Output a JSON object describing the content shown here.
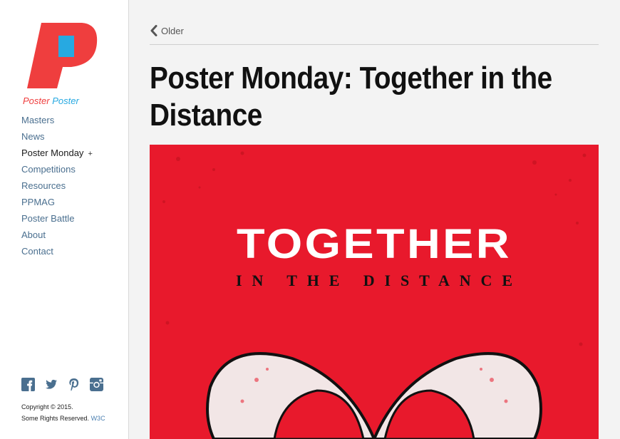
{
  "logo": {
    "word1": "Poster",
    "word2": "Poster"
  },
  "nav": [
    {
      "label": "Masters",
      "active": false
    },
    {
      "label": "News",
      "active": false
    },
    {
      "label": "Poster Monday",
      "active": true,
      "suffix": "+"
    },
    {
      "label": "Competitions",
      "active": false
    },
    {
      "label": "Resources",
      "active": false
    },
    {
      "label": "PPMAG",
      "active": false
    },
    {
      "label": "Poster Battle",
      "active": false
    },
    {
      "label": "About",
      "active": false
    },
    {
      "label": "Contact",
      "active": false
    }
  ],
  "social": [
    "facebook-icon",
    "twitter-icon",
    "pinterest-icon",
    "instagram-icon"
  ],
  "footer": {
    "copyright": "Copyright © 2015.",
    "rights": "Some Rights Reserved.",
    "w3c": "W3C"
  },
  "post": {
    "older_label": "Older",
    "title": "Poster Monday: Together in the Distance",
    "poster": {
      "headline": "TOGETHER",
      "subline": "IN THE DISTANCE"
    }
  },
  "colors": {
    "logo_red": "#ef3e3e",
    "logo_blue": "#27a9e1",
    "nav_link": "#4a6f8f",
    "poster_red": "#e8192c"
  }
}
